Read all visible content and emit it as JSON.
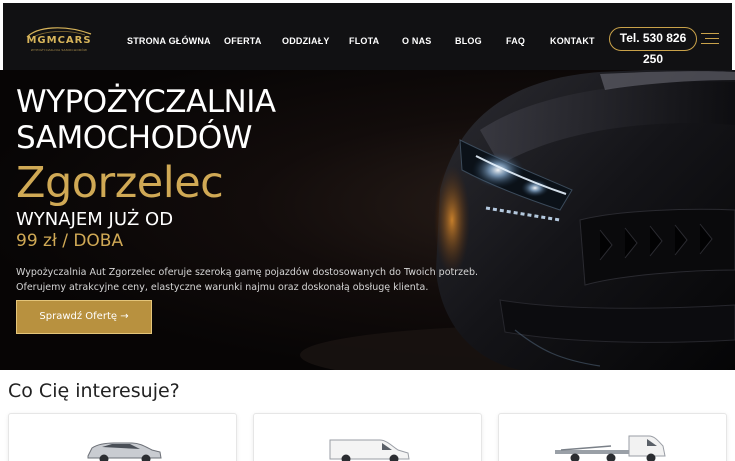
{
  "header": {
    "logo_text": "MGMCARS",
    "logo_subtext": "WYPOŻYCZALNIA SAMOCHODÓW",
    "nav": [
      {
        "label": "STRONA GŁÓWNA"
      },
      {
        "label": "OFERTA"
      },
      {
        "label": "ODDZIAŁY"
      },
      {
        "label": "FLOTA"
      },
      {
        "label": "O NAS"
      },
      {
        "label": "BLOG"
      },
      {
        "label": "FAQ"
      },
      {
        "label": "KONTAKT"
      }
    ],
    "phone": "Tel. 530 826 250",
    "menu_icon": "hamburger-menu-icon"
  },
  "hero": {
    "title_line1": "WYPOŻYCZALNIA",
    "title_line2": "SAMOCHODÓW",
    "city": "Zgorzelec",
    "subtitle": "WYNAJEM JUŻ OD",
    "price": "99 zł / DOBA",
    "description_line1": "Wypożyczalnia Aut Zgorzelec oferuje szeroką gamę pojazdów dostosowanych do Twoich potrzeb.",
    "description_line2": "Oferujemy atrakcyjne ceny, elastyczne warunki najmu oraz doskonałą obsługę klienta.",
    "cta_label": "Sprawdź Ofertę →"
  },
  "section": {
    "title": "Co Cię interesuje?",
    "cards": [
      {
        "icon": "suv-car-icon"
      },
      {
        "icon": "delivery-van-icon"
      },
      {
        "icon": "tow-truck-icon"
      }
    ]
  },
  "colors": {
    "accent_gold": "#c9a24a",
    "header_bg": "#111113",
    "hero_bg": "#070505"
  }
}
